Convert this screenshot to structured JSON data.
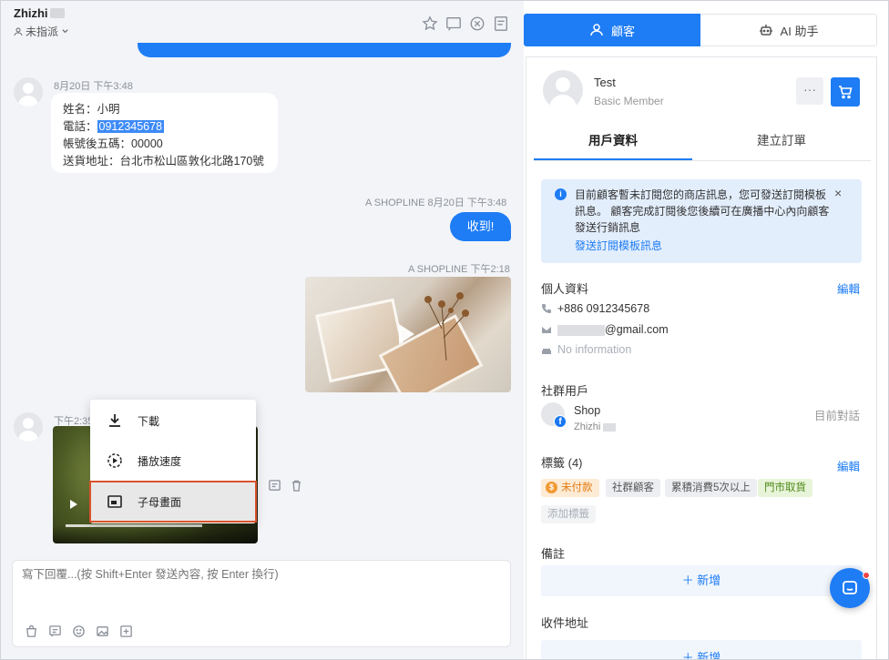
{
  "chat": {
    "name": "Zhizhi",
    "assign_label": "未指派",
    "messages": [
      {
        "meta": "8月20日 下午3:48",
        "lines": [
          "姓名：小明",
          "電話：",
          "0912345678",
          "帳號後五碼：00000",
          "送貨地址：台北市松山區敦化北路170號"
        ]
      },
      {
        "meta": "A SHOPLINE 8月20日 下午3:48",
        "text": "收到!"
      },
      {
        "meta": "A SHOPLINE 下午2:18"
      },
      {
        "meta": "下午2:35"
      }
    ],
    "context_menu": [
      "下載",
      "播放速度",
      "子母畫面"
    ],
    "composer_placeholder": "寫下回覆...(按 Shift+Enter 發送內容, 按 Enter 換行)"
  },
  "side": {
    "tabs": [
      "顧客",
      "AI 助手"
    ],
    "customer": {
      "name": "Test",
      "level": "Basic Member",
      "more": "···"
    },
    "inner_tabs": [
      "用戶資料",
      "建立訂單"
    ],
    "notice": {
      "text": "目前顧客暫未訂閱您的商店訊息，您可發送訂閱模板訊息。 顧客完成訂閱後您後續可在廣播中心內向顧客發送行銷訊息",
      "link": "發送訂閱模板訊息",
      "close": "×"
    },
    "personal": {
      "title": "個人資料",
      "edit": "編輯",
      "phone": "+886 0912345678",
      "email": "@gmail.com",
      "birthday": "No information"
    },
    "social": {
      "title": "社群用戶",
      "shop": "Shop",
      "handle": "Zhizhi",
      "status": "目前對話",
      "badge": "f"
    },
    "tags": {
      "title": "標籤 (4)",
      "edit": "編輯",
      "items": [
        "未付款",
        "社群顧客",
        "累積消費5次以上",
        "門市取貨"
      ],
      "add": "添加標籤"
    },
    "notes": {
      "title": "備註",
      "add": "＋ 新增"
    },
    "address": {
      "title": "收件地址",
      "add": "＋ 新增"
    }
  },
  "colors": {
    "primary": "#1e7cf5",
    "unpaid": "#e27c10",
    "highlight_outline": "#d9532b"
  }
}
